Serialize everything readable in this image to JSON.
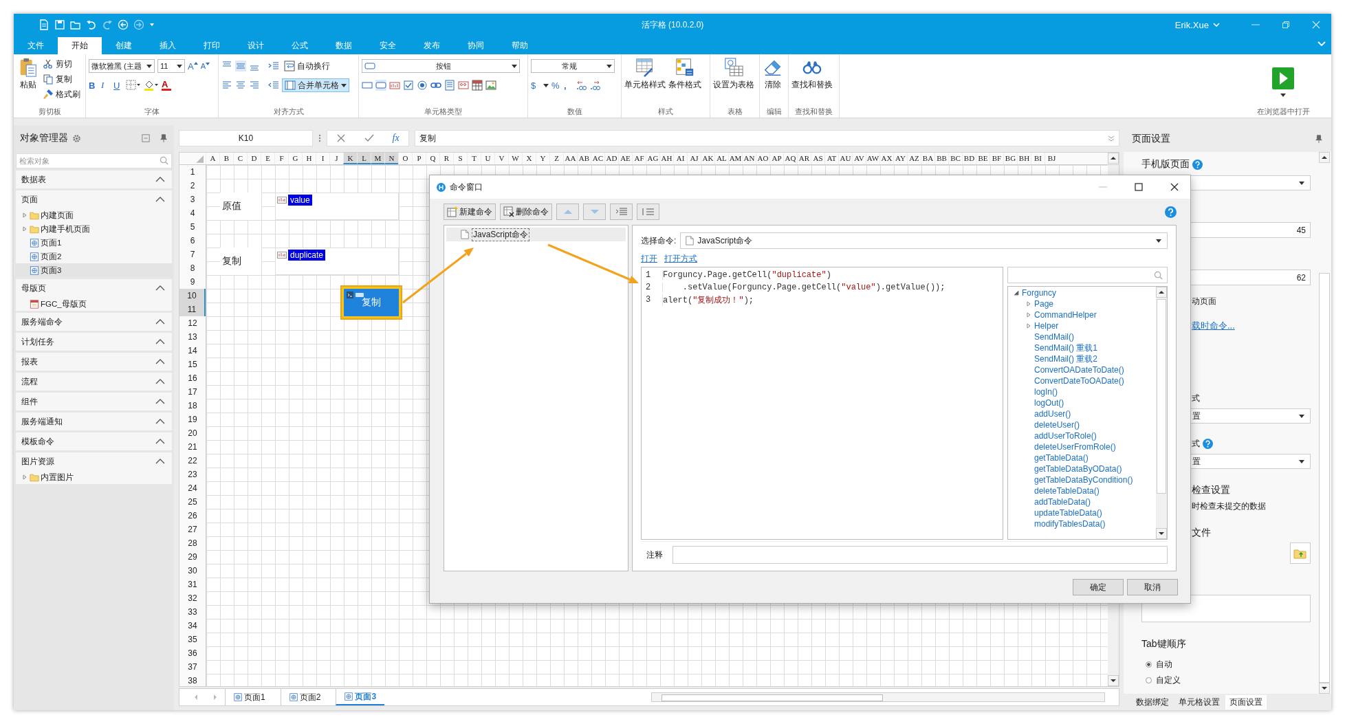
{
  "window": {
    "title": "活字格 (10.0.2.0)",
    "user": "Erik.Xue"
  },
  "ribbon_tabs": [
    {
      "label": "文件",
      "selected": false
    },
    {
      "label": "开始",
      "selected": true
    },
    {
      "label": "创建",
      "selected": false
    },
    {
      "label": "插入",
      "selected": false
    },
    {
      "label": "打印",
      "selected": false
    },
    {
      "label": "设计",
      "selected": false
    },
    {
      "label": "公式",
      "selected": false
    },
    {
      "label": "数据",
      "selected": false
    },
    {
      "label": "安全",
      "selected": false
    },
    {
      "label": "发布",
      "selected": false
    },
    {
      "label": "协同",
      "selected": false
    },
    {
      "label": "帮助",
      "selected": false
    }
  ],
  "ribbon": {
    "clipboard": {
      "label": "剪切板",
      "paste": "粘贴",
      "cut": "剪切",
      "copy": "复制",
      "painter": "格式刷"
    },
    "font": {
      "label": "字体",
      "family": "微软雅黑 (主题",
      "size": "11",
      "grow": "A",
      "shrink": "A",
      "bold": "B",
      "italic": "I",
      "underline": "U",
      "font_color_button": "A"
    },
    "align": {
      "label": "对齐方式",
      "wrap": "自动换行",
      "merge": "合并单元格",
      "merge_on": true
    },
    "cell_type": {
      "label": "单元格类型",
      "value": "按钮"
    },
    "number": {
      "label": "数值",
      "format": "常规",
      "currency": "$",
      "percent": "%",
      "comma": ","
    },
    "style": {
      "label": "样式",
      "cell_style": "单元格样式",
      "conditional": "条件格式"
    },
    "table": {
      "label": "表格",
      "action": "设置为表格"
    },
    "edit": {
      "label": "编辑",
      "action": "清除"
    },
    "find": {
      "label": "查找和替换",
      "action": "查找和替换"
    },
    "run": {
      "label": "在浏览器中打开"
    }
  },
  "formula_bar": {
    "cell": "K10",
    "fx": "fx",
    "value": "复制"
  },
  "object_manager": {
    "title": "对象管理器",
    "placeholder": "检索对象",
    "sections": [
      {
        "label": "数据表",
        "expanded": true
      },
      {
        "label": "页面",
        "expanded": true,
        "children": [
          {
            "label": "内建页面",
            "kind": "folder",
            "selected": false
          },
          {
            "label": "内建手机页面",
            "kind": "folder",
            "selected": false
          },
          {
            "label": "页面1",
            "kind": "page",
            "selected": false
          },
          {
            "label": "页面2",
            "kind": "page",
            "selected": false
          },
          {
            "label": "页面3",
            "kind": "page",
            "selected": true
          }
        ]
      },
      {
        "label": "母版页",
        "expanded": true,
        "children": [
          {
            "label": "FGC_母版页",
            "kind": "master",
            "selected": false
          }
        ]
      },
      {
        "label": "服务端命令",
        "expanded": true
      },
      {
        "label": "计划任务",
        "expanded": true
      },
      {
        "label": "报表",
        "expanded": true
      },
      {
        "label": "流程",
        "expanded": true
      },
      {
        "label": "组件",
        "expanded": true
      },
      {
        "label": "服务端通知",
        "expanded": true
      },
      {
        "label": "模板命令",
        "expanded": true
      },
      {
        "label": "图片资源",
        "expanded": true,
        "children": [
          {
            "label": "内置图片",
            "kind": "folder",
            "selected": false
          }
        ]
      }
    ]
  },
  "sheet": {
    "columns": [
      {
        "label": "A",
        "selected": false
      },
      {
        "label": "B",
        "selected": false
      },
      {
        "label": "C",
        "selected": false
      },
      {
        "label": "D",
        "selected": false
      },
      {
        "label": "E",
        "selected": false
      },
      {
        "label": "F",
        "selected": false
      },
      {
        "label": "G",
        "selected": false
      },
      {
        "label": "H",
        "selected": false
      },
      {
        "label": "I",
        "selected": false
      },
      {
        "label": "J",
        "selected": false
      },
      {
        "label": "K",
        "selected": true
      },
      {
        "label": "L",
        "selected": true
      },
      {
        "label": "M",
        "selected": true
      },
      {
        "label": "N",
        "selected": true
      },
      {
        "label": "O",
        "selected": false
      },
      {
        "label": "P",
        "selected": false
      },
      {
        "label": "Q",
        "selected": false
      },
      {
        "label": "R",
        "selected": false
      },
      {
        "label": "S",
        "selected": false
      },
      {
        "label": "T",
        "selected": false
      },
      {
        "label": "U",
        "selected": false
      },
      {
        "label": "V",
        "selected": false
      },
      {
        "label": "W",
        "selected": false
      },
      {
        "label": "X",
        "selected": false
      },
      {
        "label": "Y",
        "selected": false
      },
      {
        "label": "Z",
        "selected": false
      },
      {
        "label": "AA",
        "selected": false
      },
      {
        "label": "AB",
        "selected": false
      },
      {
        "label": "AC",
        "selected": false
      },
      {
        "label": "AD",
        "selected": false
      },
      {
        "label": "AE",
        "selected": false
      },
      {
        "label": "AF",
        "selected": false
      },
      {
        "label": "AG",
        "selected": false
      },
      {
        "label": "AH",
        "selected": false
      },
      {
        "label": "AI",
        "selected": false
      },
      {
        "label": "AJ",
        "selected": false
      },
      {
        "label": "AK",
        "selected": false
      },
      {
        "label": "AL",
        "selected": false
      },
      {
        "label": "AM",
        "selected": false
      },
      {
        "label": "AN",
        "selected": false
      },
      {
        "label": "AO",
        "selected": false
      },
      {
        "label": "AP",
        "selected": false
      },
      {
        "label": "AQ",
        "selected": false
      },
      {
        "label": "AR",
        "selected": false
      },
      {
        "label": "AS",
        "selected": false
      },
      {
        "label": "AT",
        "selected": false
      },
      {
        "label": "AU",
        "selected": false
      },
      {
        "label": "AV",
        "selected": false
      },
      {
        "label": "AW",
        "selected": false
      },
      {
        "label": "AX",
        "selected": false
      },
      {
        "label": "AY",
        "selected": false
      },
      {
        "label": "AZ",
        "selected": false
      },
      {
        "label": "BA",
        "selected": false
      },
      {
        "label": "BB",
        "selected": false
      },
      {
        "label": "BC",
        "selected": false
      },
      {
        "label": "BD",
        "selected": false
      },
      {
        "label": "BE",
        "selected": false
      },
      {
        "label": "BF",
        "selected": false
      },
      {
        "label": "BG",
        "selected": false
      },
      {
        "label": "BH",
        "selected": false
      },
      {
        "label": "BI",
        "selected": false
      },
      {
        "label": "BJ",
        "selected": false
      }
    ],
    "rows": [
      {
        "label": "1",
        "selected": false
      },
      {
        "label": "2",
        "selected": false
      },
      {
        "label": "3",
        "selected": false
      },
      {
        "label": "4",
        "selected": false
      },
      {
        "label": "5",
        "selected": false
      },
      {
        "label": "6",
        "selected": false
      },
      {
        "label": "7",
        "selected": false
      },
      {
        "label": "8",
        "selected": false
      },
      {
        "label": "9",
        "selected": false
      },
      {
        "label": "10",
        "selected": true
      },
      {
        "label": "11",
        "selected": true
      },
      {
        "label": "12",
        "selected": false
      },
      {
        "label": "13",
        "selected": false
      },
      {
        "label": "14",
        "selected": false
      },
      {
        "label": "15",
        "selected": false
      },
      {
        "label": "16",
        "selected": false
      },
      {
        "label": "17",
        "selected": false
      },
      {
        "label": "18",
        "selected": false
      },
      {
        "label": "19",
        "selected": false
      },
      {
        "label": "20",
        "selected": false
      },
      {
        "label": "21",
        "selected": false
      },
      {
        "label": "22",
        "selected": false
      },
      {
        "label": "23",
        "selected": false
      },
      {
        "label": "24",
        "selected": false
      },
      {
        "label": "25",
        "selected": false
      },
      {
        "label": "26",
        "selected": false
      },
      {
        "label": "27",
        "selected": false
      },
      {
        "label": "28",
        "selected": false
      },
      {
        "label": "29",
        "selected": false
      },
      {
        "label": "30",
        "selected": false
      },
      {
        "label": "31",
        "selected": false
      },
      {
        "label": "32",
        "selected": false
      },
      {
        "label": "33",
        "selected": false
      },
      {
        "label": "34",
        "selected": false
      },
      {
        "label": "35",
        "selected": false
      },
      {
        "label": "36",
        "selected": false
      },
      {
        "label": "37",
        "selected": false
      },
      {
        "label": "38",
        "selected": false
      }
    ],
    "cells": [
      {
        "kind": "label",
        "text": "原值"
      },
      {
        "kind": "textbox",
        "text": "value"
      },
      {
        "kind": "label",
        "text": "复制"
      },
      {
        "kind": "textbox",
        "text": "duplicate"
      },
      {
        "kind": "button",
        "text": "复制",
        "selected": true
      }
    ],
    "tabs": [
      {
        "label": "页面1",
        "selected": false
      },
      {
        "label": "页面2",
        "selected": false
      },
      {
        "label": "页面3",
        "selected": true
      }
    ]
  },
  "dialog": {
    "title": "命令窗口",
    "new_command": "新建命令",
    "delete_command": "删除命令",
    "commands": [
      {
        "label": "JavaScript命令",
        "selected": true
      }
    ],
    "select_label": "选择命令:",
    "select_value": "JavaScript命令",
    "links": [
      "打开",
      "打开方式"
    ],
    "code": [
      {
        "number": "1",
        "text": "Forguncy.Page.getCell(\"duplicate\")"
      },
      {
        "number": "2",
        "text": "    .setValue(Forguncy.Page.getCell(\"value\").getValue());"
      },
      {
        "number": "3",
        "text": "alert(\"复制成功！\");"
      }
    ],
    "api_tree": [
      {
        "label": "Forguncy",
        "kind": "namespace",
        "expanded": true,
        "children": [
          {
            "label": "Page",
            "kind": "namespace",
            "expanded": false
          },
          {
            "label": "CommandHelper",
            "kind": "namespace",
            "expanded": false
          },
          {
            "label": "Helper",
            "kind": "namespace",
            "expanded": false
          },
          {
            "label": "SendMail()",
            "kind": "method"
          },
          {
            "label": "SendMail() 重载1",
            "kind": "method"
          },
          {
            "label": "SendMail() 重载2",
            "kind": "method"
          },
          {
            "label": "ConvertOADateToDate()",
            "kind": "method"
          },
          {
            "label": "ConvertDateToOADate()",
            "kind": "method"
          },
          {
            "label": "logIn()",
            "kind": "method"
          },
          {
            "label": "logOut()",
            "kind": "method"
          },
          {
            "label": "addUser()",
            "kind": "method"
          },
          {
            "label": "deleteUser()",
            "kind": "method"
          },
          {
            "label": "addUserToRole()",
            "kind": "method"
          },
          {
            "label": "deleteUserFromRole()",
            "kind": "method"
          },
          {
            "label": "getTableData()",
            "kind": "method"
          },
          {
            "label": "getTableDataByOData()",
            "kind": "method"
          },
          {
            "label": "getTableDataByCondition()",
            "kind": "method"
          },
          {
            "label": "deleteTableData()",
            "kind": "method"
          },
          {
            "label": "addTableData()",
            "kind": "method"
          },
          {
            "label": "updateTableData()",
            "kind": "method"
          },
          {
            "label": "modifyTablesData()",
            "kind": "method"
          }
        ]
      }
    ],
    "note_label": "注释",
    "ok": "确定",
    "cancel": "取消"
  },
  "properties": {
    "title": "页面设置",
    "rows": [
      {
        "kind": "heading",
        "text": "手机版页面",
        "help": true
      },
      {
        "kind": "select"
      },
      {
        "kind": "number",
        "value": "45"
      },
      {
        "kind": "number",
        "value": "62"
      },
      {
        "kind": "text",
        "text": "动页面"
      },
      {
        "kind": "link",
        "text": "载时命令..."
      },
      {
        "kind": "text",
        "text": "式"
      },
      {
        "kind": "select",
        "value": "置"
      },
      {
        "kind": "text",
        "text": "式",
        "help": true
      },
      {
        "kind": "select",
        "value": "置"
      },
      {
        "kind": "heading",
        "text": "检查设置"
      },
      {
        "kind": "text",
        "text": "时检查未提交的数据"
      },
      {
        "kind": "heading",
        "text": "文件"
      },
      {
        "kind": "file"
      },
      {
        "kind": "textarea"
      },
      {
        "kind": "heading",
        "text": "Tab键顺序"
      },
      {
        "kind": "radio",
        "text": "自动",
        "selected": true
      },
      {
        "kind": "radio",
        "text": "自定义",
        "selected": false
      }
    ],
    "tabs": [
      {
        "label": "数据绑定",
        "selected": false
      },
      {
        "label": "单元格设置",
        "selected": false
      },
      {
        "label": "页面设置",
        "selected": true
      }
    ]
  }
}
